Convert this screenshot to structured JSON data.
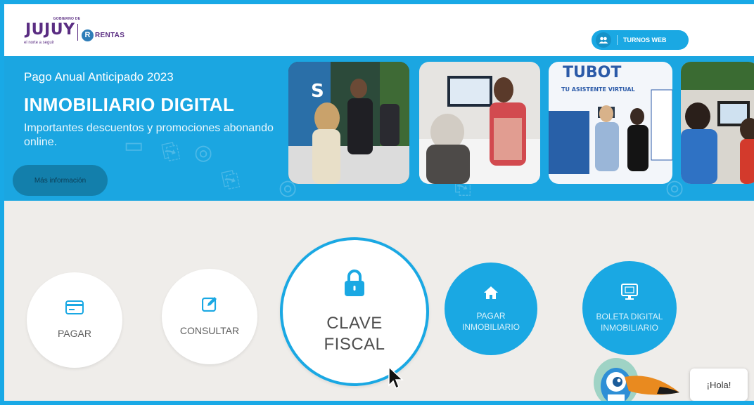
{
  "header": {
    "logo_government": "GOBIERNO DE",
    "logo_name": "JUJUY",
    "logo_tagline": "el norte a seguir",
    "logo_rentas": "RENTAS",
    "turnos_label": "TURNOS WEB"
  },
  "banner": {
    "kicker": "Pago Anual Anticipado 2023",
    "title": "INMOBILIARIO DIGITAL",
    "subtitle": "Importantes descuentos y promociones abonando online.",
    "more_label": "Más información",
    "photo_signs": [
      "S",
      "TUBOT",
      "TU ASISTENTE VIRTUAL"
    ]
  },
  "actions": {
    "pagar": "PAGAR",
    "consultar": "CONSULTAR",
    "clave_line1": "CLAVE",
    "clave_line2": "FISCAL",
    "pagar_inm_line1": "PAGAR",
    "pagar_inm_line2": "INMOBILIARIO",
    "boleta_line1": "BOLETA DIGITAL",
    "boleta_line2": "INMOBILIARIO"
  },
  "chat": {
    "greeting": "¡Hola!"
  },
  "colors": {
    "accent": "#1aa8e3",
    "brand_purple": "#5a2d82",
    "background": "#efedea"
  },
  "icons": [
    "users-icon",
    "card-icon",
    "edit-icon",
    "lock-icon",
    "home-icon",
    "monitor-icon",
    "mouse-cursor-icon",
    "bot-avatar-icon"
  ]
}
